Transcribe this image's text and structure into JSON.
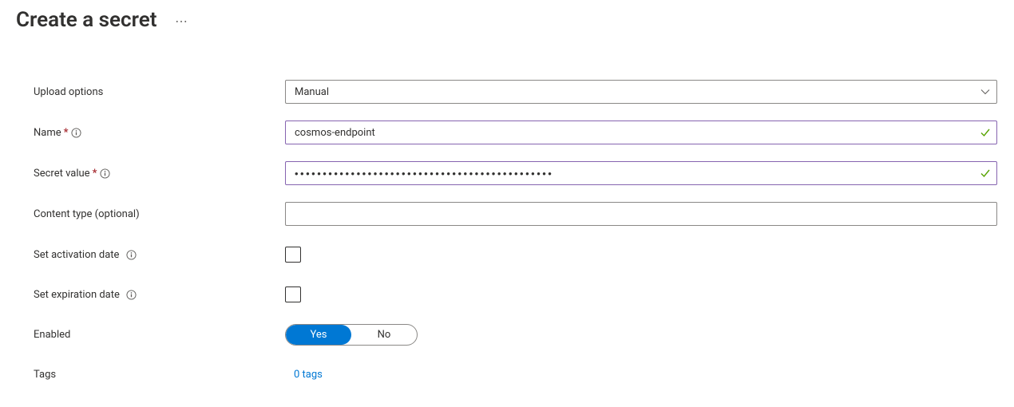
{
  "header": {
    "title": "Create a secret",
    "more_aria": "More"
  },
  "form": {
    "upload_options": {
      "label": "Upload options",
      "value": "Manual"
    },
    "name": {
      "label": "Name",
      "value": "cosmos-endpoint"
    },
    "secret_value": {
      "label": "Secret value",
      "value": "••••••••••••••••••••••••••••••••••••••••••••••"
    },
    "content_type": {
      "label": "Content type (optional)",
      "value": ""
    },
    "activation": {
      "label": "Set activation date",
      "checked": false
    },
    "expiration": {
      "label": "Set expiration date",
      "checked": false
    },
    "enabled": {
      "label": "Enabled",
      "yes": "Yes",
      "no": "No"
    },
    "tags": {
      "label": "Tags",
      "link": "0 tags"
    }
  }
}
